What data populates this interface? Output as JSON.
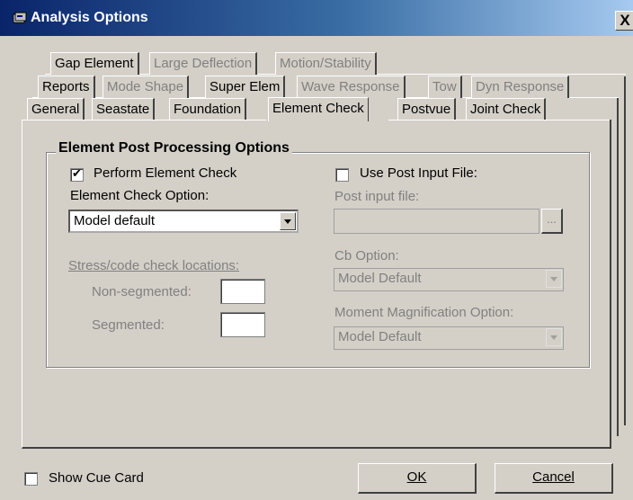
{
  "window": {
    "title": "Analysis Options",
    "close_glyph": "X"
  },
  "tabs": {
    "row1": [
      {
        "label": "Gap Element",
        "enabled": true
      },
      {
        "label": "Large Deflection",
        "enabled": false
      },
      {
        "label": "Motion/Stability",
        "enabled": false
      }
    ],
    "row2": [
      {
        "label": "Reports",
        "enabled": true
      },
      {
        "label": "Mode Shape",
        "enabled": false
      },
      {
        "label": "Super Elem",
        "enabled": true
      },
      {
        "label": "Wave Response",
        "enabled": false
      },
      {
        "label": "Tow",
        "enabled": false
      },
      {
        "label": "Dyn Response",
        "enabled": false
      }
    ],
    "row3": [
      {
        "label": "General",
        "enabled": true
      },
      {
        "label": "Seastate",
        "enabled": true
      },
      {
        "label": "Foundation",
        "enabled": true
      },
      {
        "label": "Element Check",
        "enabled": true,
        "active": true
      },
      {
        "label": "Postvue",
        "enabled": true
      },
      {
        "label": "Joint Check",
        "enabled": true
      }
    ]
  },
  "group": {
    "title": "Element Post Processing Options",
    "perform_check": {
      "label": "Perform Element Check",
      "checked": true
    },
    "check_option_label": "Element Check Option:",
    "check_option_value": "Model default",
    "stress_locations_label": "Stress/code check  locations:",
    "non_segmented_label": "Non-segmented:",
    "non_segmented_value": "",
    "segmented_label": "Segmented:",
    "segmented_value": "",
    "use_post_input": {
      "label": "Use Post Input File:",
      "checked": false
    },
    "post_input_label": "Post input file:",
    "post_input_value": "",
    "browse_label": "...",
    "cb_option_label": "Cb Option:",
    "cb_option_value": "Model Default",
    "moment_label": "Moment Magnification Option:",
    "moment_value": "Model Default"
  },
  "footer": {
    "cue_card": {
      "label": "Show Cue Card",
      "checked": false
    },
    "ok_label": "OK",
    "cancel_label": "Cancel"
  }
}
